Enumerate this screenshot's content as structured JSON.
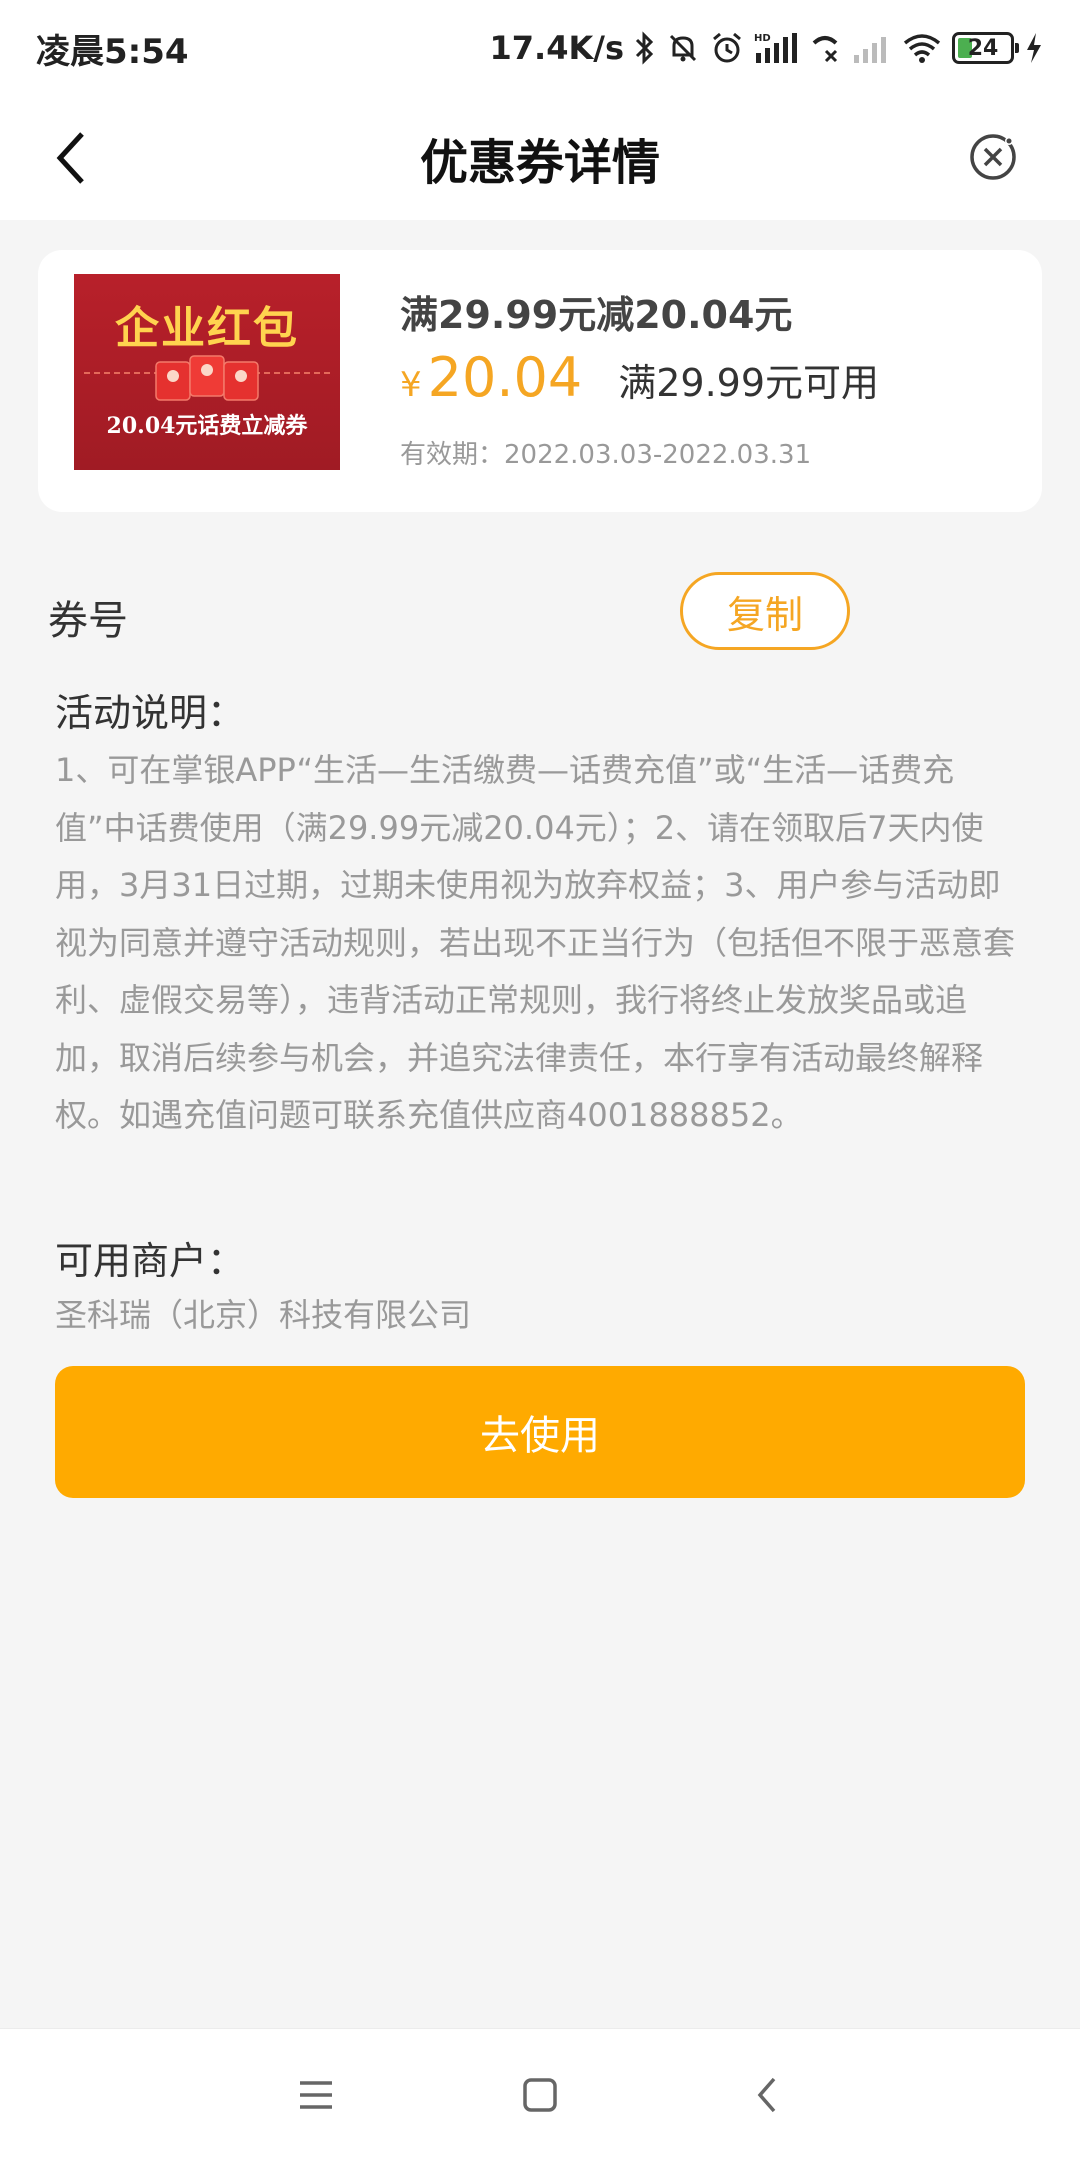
{
  "status_bar": {
    "time": "凌晨5:54",
    "network_speed": "17.4K/s",
    "battery_level": "24",
    "icons": [
      "bluetooth-icon",
      "mute-icon",
      "alarm-icon",
      "signal-hd-icon",
      "call-icon",
      "signal-weak-icon",
      "wifi-icon",
      "battery-icon",
      "charging-icon"
    ]
  },
  "nav": {
    "title": "优惠券详情",
    "back_icon": "chevron-left-icon",
    "close_icon": "close-circle-icon"
  },
  "coupon": {
    "image_brand": "企业红包",
    "image_caption": "20.04元话费立减券",
    "title": "满29.99元减20.04元",
    "currency": "¥",
    "amount": "20.04",
    "threshold": "满29.99元可用",
    "validity": "有效期：2022.03.03-2022.03.31",
    "accent_color": "#f5a623"
  },
  "code": {
    "label": "券号",
    "copy_label": "复制"
  },
  "activity": {
    "title": "活动说明：",
    "text": "1、可在掌银APP“生活—生活缴费—话费充值”或“生活—话费充值”中话费使用（满29.99元减20.04元）；2、请在领取后7天内使用，3月31日过期，过期未使用视为放弃权益；3、用户参与活动即视为同意并遵守活动规则，若出现不正当行为（包括但不限于恶意套利、虚假交易等），违背活动正常规则，我行将终止发放奖品或追加，取消后续参与机会，并追究法律责任，本行享有活动最终解释权。如遇充值问题可联系充值供应商4001888852。"
  },
  "merchant": {
    "title": "可用商户：",
    "name": "圣科瑞（北京）科技有限公司"
  },
  "use_button": {
    "label": "去使用",
    "color": "#ffaa00"
  },
  "bottom_nav": {
    "icons": [
      "menu-icon",
      "home-square-icon",
      "back-arrow-icon"
    ]
  }
}
